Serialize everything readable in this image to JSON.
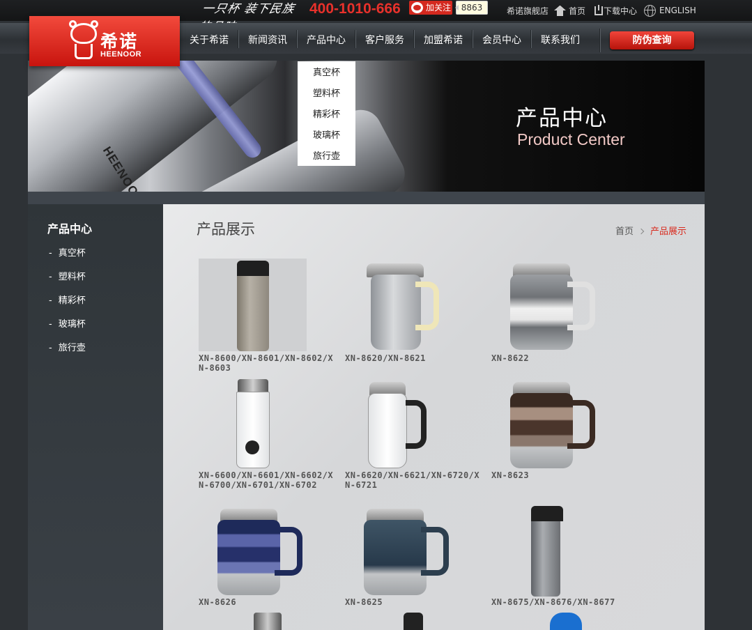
{
  "header": {
    "slogan": "一只杯 装下民族的品味",
    "phone": "400-1010-666",
    "weibo_follow": "加关注",
    "weibo_count": "8863",
    "links": {
      "flagship": "希诺旗舰店",
      "home": "首页",
      "download": "下载中心",
      "english": "ENGLISH"
    }
  },
  "logo": {
    "cn": "希诺",
    "en": "HEENOOR"
  },
  "nav": {
    "items": [
      "关于希诺",
      "新闻资讯",
      "产品中心",
      "客户服务",
      "加盟希诺",
      "会员中心",
      "联系我们"
    ],
    "verify_button": "防伪查询"
  },
  "dropdown": {
    "items": [
      "真空杯",
      "塑料杯",
      "精彩杯",
      "玻璃杯",
      "旅行壶"
    ]
  },
  "banner": {
    "title_cn": "产品中心",
    "title_en": "Product Center",
    "brand_mark": "HEENOOR"
  },
  "sidebar": {
    "title": "产品中心",
    "items": [
      "真空杯",
      "塑料杯",
      "精彩杯",
      "玻璃杯",
      "旅行壶"
    ]
  },
  "main": {
    "title": "产品展示",
    "breadcrumb": {
      "home": "首页",
      "current": "产品展示"
    },
    "products": [
      {
        "label": "XN-8600/XN-8601/XN-8602/XN-8603"
      },
      {
        "label": "XN-8620/XN-8621"
      },
      {
        "label": "XN-8622"
      },
      {
        "label": "XN-6600/XN-6601/XN-6602/XN-6700/XN-6701/XN-6702"
      },
      {
        "label": "XN-6620/XN-6621/XN-6720/XN-6721"
      },
      {
        "label": "XN-8623"
      },
      {
        "label": "XN-8626"
      },
      {
        "label": "XN-8625"
      },
      {
        "label": "XN-8675/XN-8676/XN-8677"
      }
    ]
  }
}
